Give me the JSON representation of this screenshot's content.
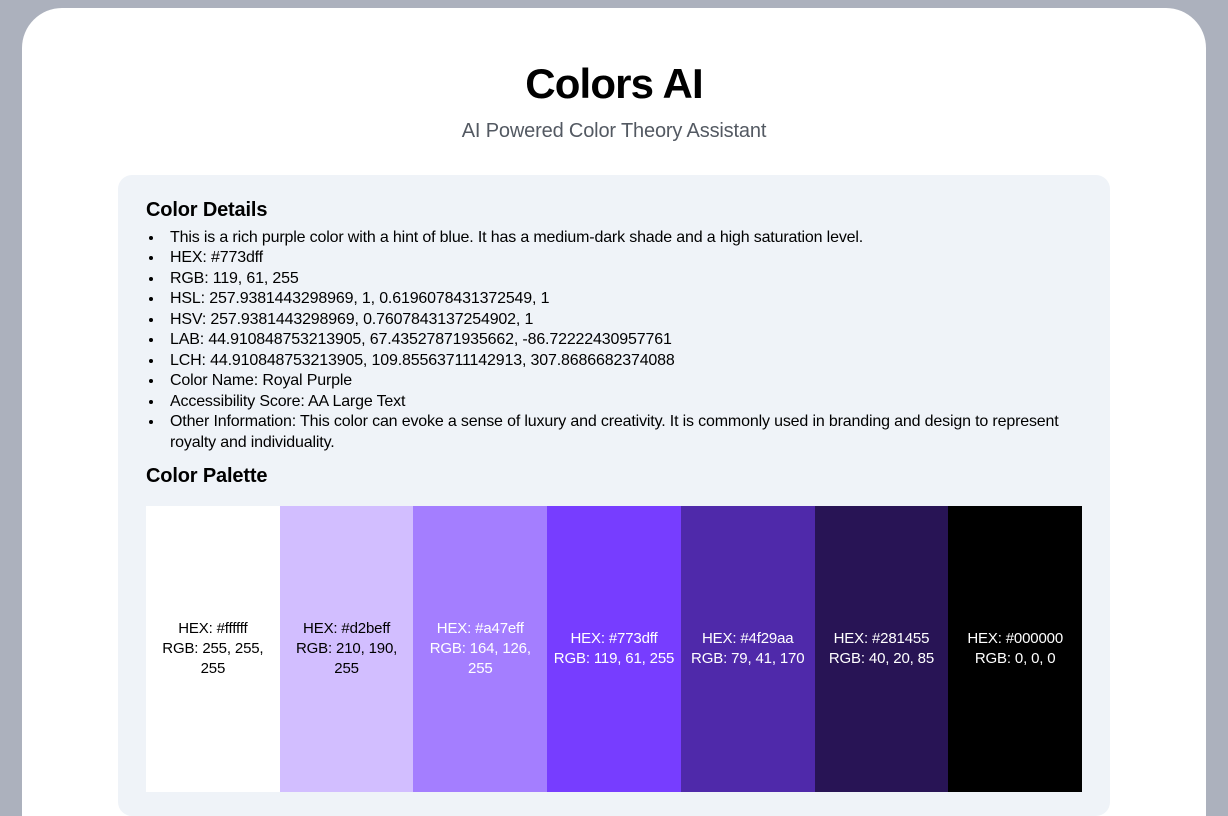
{
  "header": {
    "title": "Colors AI",
    "subtitle": "AI Powered Color Theory Assistant"
  },
  "details_heading": "Color Details",
  "details": [
    "This is a rich purple color with a hint of blue. It has a medium-dark shade and a high saturation level.",
    "HEX: #773dff",
    "RGB: 119, 61, 255",
    "HSL: 257.9381443298969, 1, 0.6196078431372549, 1",
    "HSV: 257.9381443298969, 0.7607843137254902, 1",
    "LAB: 44.910848753213905, 67.43527871935662, -86.72222430957761",
    "LCH: 44.910848753213905, 109.85563711142913, 307.8686682374088",
    "Color Name: Royal Purple",
    "Accessibility Score: AA Large Text",
    "Other Information: This color can evoke a sense of luxury and creativity. It is commonly used in branding and design to represent royalty and individuality."
  ],
  "palette_heading": "Color Palette",
  "palette": [
    {
      "bg": "#ffffff",
      "fg": "#000000",
      "hex": "HEX: #ffffff",
      "rgb": "RGB: 255, 255, 255"
    },
    {
      "bg": "#d2beff",
      "fg": "#000000",
      "hex": "HEX: #d2beff",
      "rgb": "RGB: 210, 190, 255"
    },
    {
      "bg": "#a47eff",
      "fg": "#ffffff",
      "hex": "HEX: #a47eff",
      "rgb": "RGB: 164, 126, 255"
    },
    {
      "bg": "#773dff",
      "fg": "#ffffff",
      "hex": "HEX: #773dff",
      "rgb": "RGB: 119, 61, 255"
    },
    {
      "bg": "#4f29aa",
      "fg": "#ffffff",
      "hex": "HEX: #4f29aa",
      "rgb": "RGB: 79, 41, 170"
    },
    {
      "bg": "#281455",
      "fg": "#ffffff",
      "hex": "HEX: #281455",
      "rgb": "RGB: 40, 20, 85"
    },
    {
      "bg": "#000000",
      "fg": "#ffffff",
      "hex": "HEX: #000000",
      "rgb": "RGB: 0, 0, 0"
    }
  ]
}
